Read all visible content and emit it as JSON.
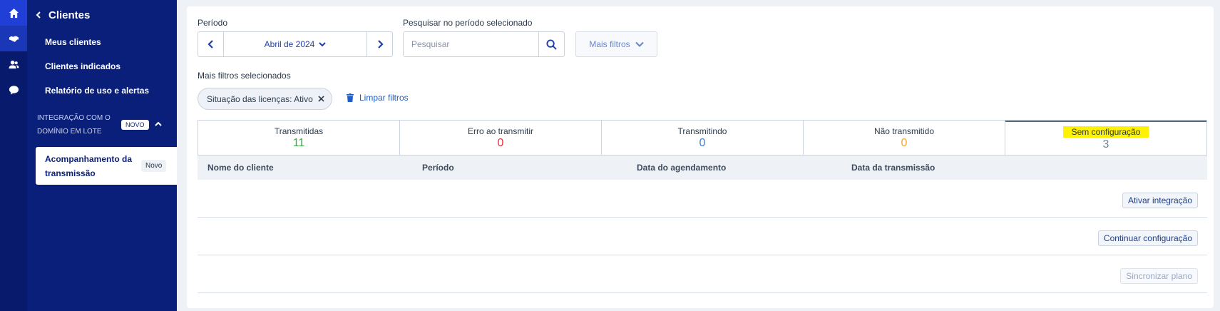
{
  "rail": {
    "icons": [
      "home-icon",
      "handshake-icon",
      "users-icon",
      "chat-icon"
    ]
  },
  "nav": {
    "title": "Clientes",
    "items": [
      {
        "label": "Meus clientes"
      },
      {
        "label": "Clientes indicados"
      },
      {
        "label": "Relatório de uso e alertas"
      }
    ],
    "group": {
      "label": "INTEGRAÇÃO COM O DOMÍNIO EM LOTE",
      "badge": "NOVO"
    },
    "sub": {
      "label": "Acompanhamento da transmissão",
      "badge": "Novo"
    }
  },
  "filters": {
    "period_label": "Período",
    "period_value": "Abril de 2024",
    "search_label": "Pesquisar no período selecionado",
    "search_placeholder": "Pesquisar",
    "more_filters": "Mais filtros",
    "selected_label": "Mais filtros selecionados",
    "chip": "Situação das licenças: Ativo",
    "clear": "Limpar filtros"
  },
  "tabs": [
    {
      "label": "Transmitidas",
      "count": "11",
      "color": "#3fa84a"
    },
    {
      "label": "Erro ao transmitir",
      "count": "0",
      "color": "#e0323c"
    },
    {
      "label": "Transmitindo",
      "count": "0",
      "color": "#3a7fd6"
    },
    {
      "label": "Não transmitido",
      "count": "0",
      "color": "#f0a832"
    },
    {
      "label": "Sem configuração",
      "count": "3",
      "color": "#7a8494",
      "highlight": "#fff200"
    }
  ],
  "table": {
    "headers": [
      "Nome do cliente",
      "Período",
      "Data do agendamento",
      "Data da transmissão"
    ],
    "rows": [
      {
        "action": "Ativar integração",
        "disabled": false
      },
      {
        "action": "Continuar configuração",
        "disabled": false
      },
      {
        "action": "Sincronizar plano",
        "disabled": true
      }
    ]
  }
}
